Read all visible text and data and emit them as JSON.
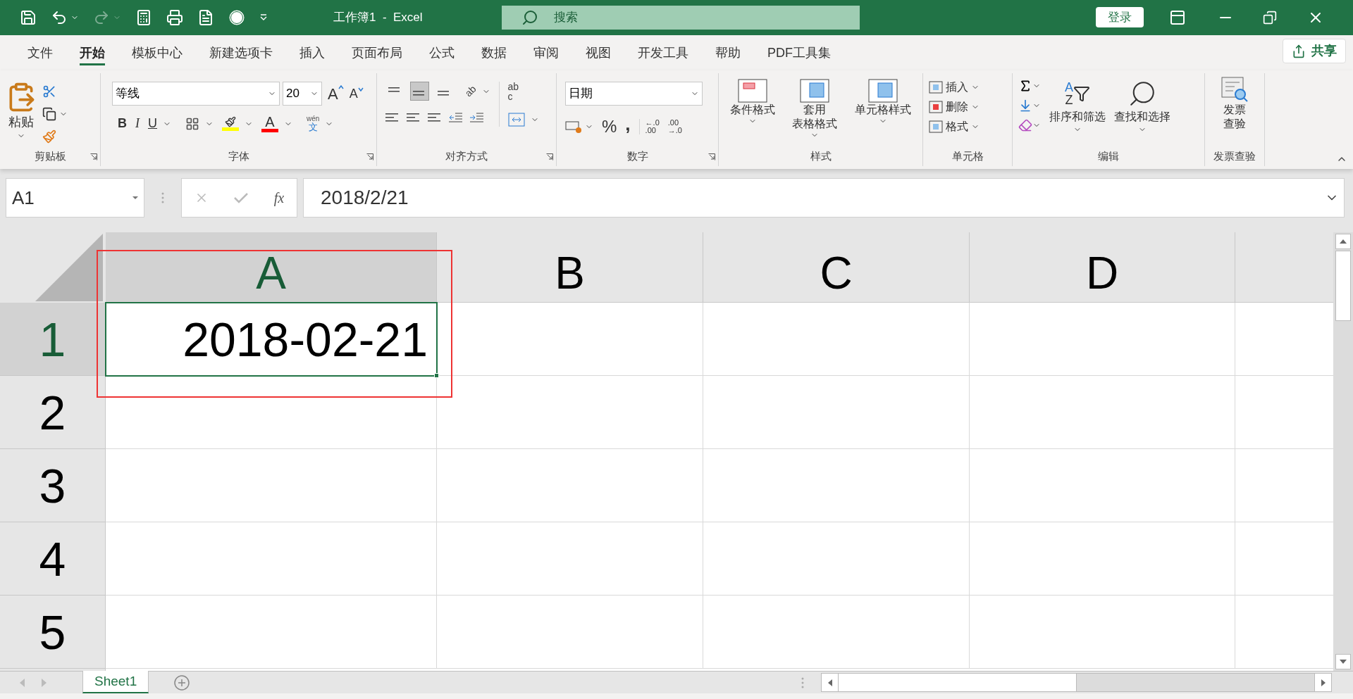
{
  "title_bar": {
    "title": "工作簿1  -  Excel",
    "search_placeholder": "搜索",
    "login": "登录"
  },
  "tabs": [
    {
      "label": "文件",
      "selected": false
    },
    {
      "label": "开始",
      "selected": true
    },
    {
      "label": "模板中心",
      "selected": false
    },
    {
      "label": "新建选项卡",
      "selected": false
    },
    {
      "label": "插入",
      "selected": false
    },
    {
      "label": "页面布局",
      "selected": false
    },
    {
      "label": "公式",
      "selected": false
    },
    {
      "label": "数据",
      "selected": false
    },
    {
      "label": "审阅",
      "selected": false
    },
    {
      "label": "视图",
      "selected": false
    },
    {
      "label": "开发工具",
      "selected": false
    },
    {
      "label": "帮助",
      "selected": false
    },
    {
      "label": "PDF工具集",
      "selected": false
    }
  ],
  "share": "共享",
  "ribbon": {
    "clipboard": {
      "label": "剪贴板",
      "paste": "粘贴"
    },
    "font": {
      "label": "字体",
      "font_name": "等线",
      "font_size": "20",
      "grow": "A",
      "shrink": "A",
      "styles": [
        "B",
        "I",
        "U"
      ],
      "color_letter": "A",
      "phonetic_top": "wén",
      "phonetic_bottom": "文"
    },
    "alignment": {
      "label": "对齐方式",
      "vertical": [
        {
          "selected": false
        },
        {
          "selected": true
        },
        {
          "selected": false
        }
      ],
      "orient": "ab",
      "wrap_top": "ab",
      "wrap_bottom": "c"
    },
    "number": {
      "label": "数字",
      "format": "日期",
      "percent": "%",
      "comma": ",",
      "decimal_a": [
        "←.0",
        ".00"
      ],
      "decimal_b": [
        ".00",
        "→.0"
      ]
    },
    "styles": {
      "label": "样式",
      "buttons": [
        [
          "条件格式"
        ],
        [
          "套用",
          "表格格式"
        ],
        [
          "单元格样式"
        ]
      ]
    },
    "cells": {
      "label": "单元格",
      "buttons": [
        "插入",
        "删除",
        "格式"
      ]
    },
    "editing": {
      "label": "编辑",
      "sort_letters": [
        "A",
        "Z"
      ],
      "buttons": [
        "排序和筛选",
        "查找和选择"
      ]
    },
    "invoice": {
      "label": "发票查验",
      "button": [
        "发票",
        "查验"
      ]
    }
  },
  "formula_bar": {
    "name_box": "A1",
    "fx": "fx",
    "value": "2018/2/21"
  },
  "columns": [
    {
      "label": "A",
      "selected": true
    },
    {
      "label": "B",
      "selected": false
    },
    {
      "label": "C",
      "selected": false
    },
    {
      "label": "D",
      "selected": false
    }
  ],
  "rows": [
    {
      "label": "1",
      "selected": true,
      "cells": [
        "2018-02-21"
      ]
    },
    {
      "label": "2",
      "selected": false,
      "cells": []
    },
    {
      "label": "3",
      "selected": false,
      "cells": []
    },
    {
      "label": "4",
      "selected": false,
      "cells": []
    },
    {
      "label": "5",
      "selected": false,
      "cells": []
    }
  ],
  "sheets": [
    {
      "name": "Sheet1",
      "selected": true
    }
  ]
}
